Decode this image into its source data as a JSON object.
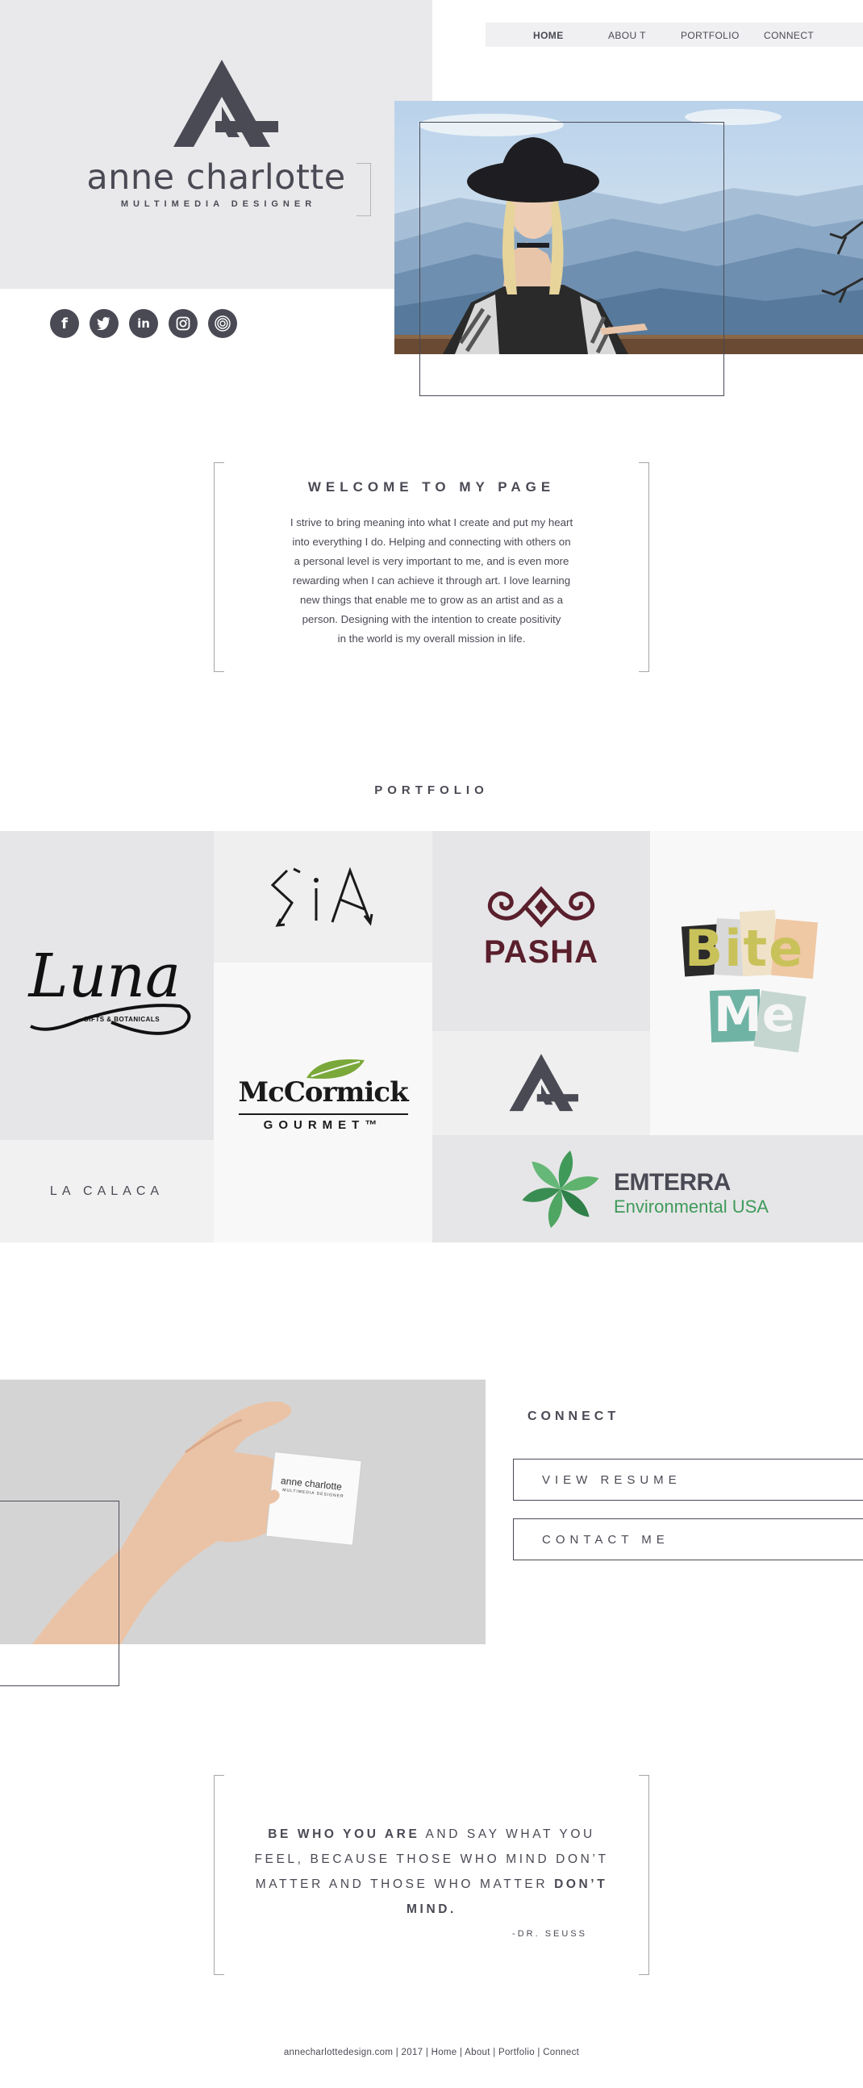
{
  "brand": {
    "name": "anne charlotte",
    "tagline": "MULTIMEDIA DESIGNER"
  },
  "nav": {
    "items": [
      {
        "label": "HOME",
        "active": true
      },
      {
        "label": "ABOU T",
        "active": false
      },
      {
        "label": "PORTFOLIO",
        "active": false
      },
      {
        "label": "CONNECT",
        "active": false
      }
    ]
  },
  "social": [
    {
      "icon": "facebook-icon",
      "glyph": "f"
    },
    {
      "icon": "twitter-icon",
      "glyph": "t"
    },
    {
      "icon": "linkedin-icon",
      "glyph": "in"
    },
    {
      "icon": "instagram-icon",
      "glyph": "◎"
    },
    {
      "icon": "target-icon",
      "glyph": "◉"
    }
  ],
  "welcome": {
    "title": "WELCOME TO MY PAGE",
    "lines": [
      "I strive to bring meaning into what I create and put my heart",
      "into everything I do. Helping and connecting with others on",
      "a personal level is very important to me, and is even more",
      "rewarding when I can achieve it through art. I love learning",
      "new things that enable me to grow as an artist and as a",
      "person. Designing with the intention to create positivity",
      "in the world is my overall mission in life."
    ]
  },
  "portfolio": {
    "title": "PORTFOLIO",
    "tiles": {
      "luna": {
        "name": "Luna",
        "sub": "GIFTS & BOTANICALS"
      },
      "lacalaca": {
        "name": "LA CALACA"
      },
      "sia": {
        "name": "SiA"
      },
      "mccormick": {
        "name": "McCormick",
        "sub": "GOURMET™"
      },
      "pasha": {
        "name": "PASHA"
      },
      "biteme": {
        "word1": "Bite",
        "word2": "Me"
      },
      "emterra": {
        "name": "EMTERRA",
        "sub": "Environmental USA"
      }
    }
  },
  "business_card": {
    "name": "anne charlotte",
    "tagline": "MULTIMEDIA DESIGNER"
  },
  "connect": {
    "title": "CONNECT",
    "resume_label": "VIEW RESUME",
    "contact_label": "CONTACT ME"
  },
  "quote": {
    "bold1": "BE WHO YOU ARE",
    "part1": " AND SAY WHAT YOU FEEL, BECAUSE THOSE WHO MIND DON’T MATTER AND THOSE WHO MATTER ",
    "bold2": "DON’T MIND.",
    "author": "-DR. SEUSS"
  },
  "footer": {
    "site": "annecharlottedesign.com",
    "year": "2017",
    "links": [
      "Home",
      "About",
      "Portfolio",
      "Connect"
    ]
  },
  "colors": {
    "primary": "#45454f",
    "panel": "#e9e9eb",
    "pasha": "#5a1f2c",
    "emterra_green": "#3f9a5a",
    "mccormick_leaf": "#7aa83a"
  }
}
